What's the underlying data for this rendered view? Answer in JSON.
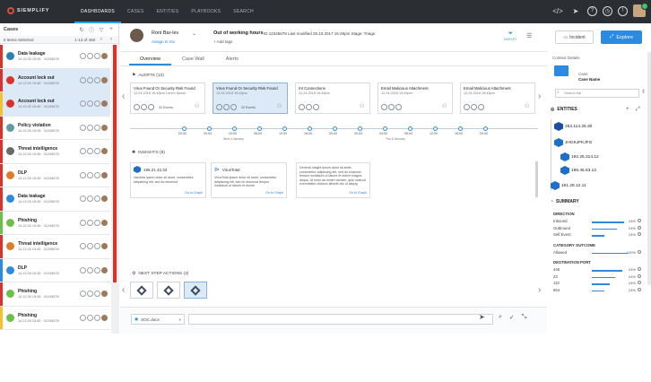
{
  "app": {
    "brand": "SIEMPLIFY"
  },
  "nav": {
    "items": [
      "DASHBOARDS",
      "CASES",
      "ENTITIES",
      "PLAYBOOKS",
      "SEARCH"
    ],
    "active": 0
  },
  "top_icons": [
    "code-icon",
    "send-icon",
    "help-icon",
    "clock-icon",
    "bell-icon"
  ],
  "left": {
    "title": "Cases",
    "selected": "5 Items Selected",
    "count": "1-13 of 468",
    "cases": [
      {
        "name": "Data leakage",
        "meta": "14.12.05 15:45 · 01245678",
        "stripe": "#d9342b",
        "logo": "#2b7fb8",
        "active": false
      },
      {
        "name": "Account lock out",
        "meta": "14.12.05 15:45 · 01245678",
        "stripe": "#d9342b",
        "logo": "#d9342b",
        "active": true
      },
      {
        "name": "Account lock out",
        "meta": "14.12.05 15:45 · 01245678",
        "stripe": "#f2c230",
        "logo": "#d9342b",
        "active": true
      },
      {
        "name": "Policy violation",
        "meta": "14.12.05 15:45 · 01245678",
        "stripe": "#d9342b",
        "logo": "#5f9ea0",
        "active": false
      },
      {
        "name": "Threat intelligence",
        "meta": "14.12.05 15:45 · 01245678",
        "stripe": "#d9342b",
        "logo": "#6a6a6a",
        "active": false
      },
      {
        "name": "DLP",
        "meta": "14.12.05 15:45 · 01245678",
        "stripe": "#d9342b",
        "logo": "#e07b2e",
        "active": false
      },
      {
        "name": "Data leakage",
        "meta": "14.12.05 15:45 · 01245678",
        "stripe": "#d9342b",
        "logo": "#2c8be0",
        "active": false
      },
      {
        "name": "Phishing",
        "meta": "14.12.05 15:45 · 01245678",
        "stripe": "#6cc04a",
        "logo": "#6cc04a",
        "active": false
      },
      {
        "name": "Threat intelligence",
        "meta": "14.12.05 15:45 · 01245678",
        "stripe": "#d9342b",
        "logo": "#e07b2e",
        "active": false
      },
      {
        "name": "DLP",
        "meta": "14.12.05 15:45 · 01245678",
        "stripe": "#2c8be0",
        "logo": "#2c8be0",
        "active": false
      },
      {
        "name": "Phishing",
        "meta": "14.12.05 15:45 · 01245678",
        "stripe": "#d9342b",
        "logo": "#6cc04a",
        "active": false
      },
      {
        "name": "Phishing",
        "meta": "14.12.05 15:45 · 01245678",
        "stripe": "#f2c230",
        "logo": "#6cc04a",
        "active": false
      }
    ]
  },
  "case_header": {
    "person": "Roni Bar-lev",
    "assign": "Assign to me",
    "sla_title": "Out of working hours",
    "meta": "ID 12345678   Last modified 25.10.2017 15:45pm   Stage: Triage",
    "add_tags": "+ Add tags",
    "filter": "SIMPLIFY",
    "incident": "Incident",
    "explore": "Explore"
  },
  "tabs": [
    "Overview",
    "Case Wall",
    "Alerts"
  ],
  "alerts": {
    "label": "ALERTS (12)",
    "items": [
      {
        "title": "Virus Found Or Security Risk Found",
        "desc": "12.24.2016 15:45pm Lorem Ipsum",
        "events": "32 Events",
        "sel": false
      },
      {
        "title": "Virus Found Or Security Risk Found",
        "desc": "12.24.2016 15:45pm",
        "events": "32 Events",
        "sel": true
      },
      {
        "title": "Int Connections",
        "desc": "12.24.2016 15:45pm",
        "events": "",
        "sel": false
      },
      {
        "title": "Email Malicious Attachment",
        "desc": "12.24.2016 15:45pm",
        "events": "",
        "sel": false
      },
      {
        "title": "Email Malicious Attachment",
        "desc": "12.24.2016 15:45pm",
        "events": "",
        "sel": false
      }
    ]
  },
  "timeline": {
    "times": [
      "20:00",
      "00:00",
      "04:00",
      "08:00",
      "12:00",
      "16:00",
      "20:00",
      "00:00",
      "04:00",
      "08:00",
      "12:00",
      "16:00",
      "20:00"
    ],
    "dates": [
      "Wed 4 January",
      "Thu 5 January"
    ]
  },
  "insights": {
    "label": "INSIGHTS (8)",
    "items": [
      {
        "title": "195.21.42.33",
        "body": "Varoista ipsum dolor sit amet, consectetur adipiscing elit, sed do eiusmod",
        "link": "Go to Graph"
      },
      {
        "title": "VirusTotal",
        "body": "VirusTotal ipsum dolor sit amet, consectetur adipiscing elit, sed do eiusmod tempor incididunt ut labore et dolore",
        "link": "Go to Graph"
      },
      {
        "title": "",
        "body": "General Insight ipsum dolor sit amet, consectetur adipiscing elit, sed do eiusmod tempor incididunt ut labore et dolore magna aliqua. Ut enim ad minim veniam, quis nostrud exercitation ullamco laboris nisi ut aliquip",
        "link": "Go to Graph"
      }
    ]
  },
  "next_steps": {
    "label": "NEXT STEP ACTIONS (3)",
    "count": 3,
    "selected": 2
  },
  "bottom": {
    "file": "SOC.docx"
  },
  "right": {
    "context": "Context Details",
    "case_label": "Case",
    "case_name": "Case Name",
    "search_placeholder": "Search bar",
    "entities_title": "ENTITIES",
    "entities": [
      "253.114.25.30",
      "JHGKJFKJFG",
      "192.25.314.12",
      "195.45.63.12",
      "191.28.12.11"
    ],
    "summary_title": "SUMMARY",
    "direction": {
      "label": "DIRECTION",
      "rows": [
        {
          "name": "Inbound",
          "pct": "24%",
          "frac": 0.9
        },
        {
          "name": "Outbound",
          "pct": "24%",
          "frac": 0.7
        },
        {
          "name": "Self Event",
          "pct": "24%",
          "frac": 0.35
        }
      ]
    },
    "outcome": {
      "label": "CATEGORY OUTCOME",
      "rows": [
        {
          "name": "Allowed",
          "pct": "100%",
          "frac": 1.0
        }
      ]
    },
    "port": {
      "label": "DESTINATION PORT",
      "rows": [
        {
          "name": "445",
          "pct": "24%",
          "frac": 0.85
        },
        {
          "name": "23",
          "pct": "24%",
          "frac": 0.65
        },
        {
          "name": "110",
          "pct": "24%",
          "frac": 0.5
        },
        {
          "name": "654",
          "pct": "24%",
          "frac": 0.35
        }
      ]
    }
  }
}
